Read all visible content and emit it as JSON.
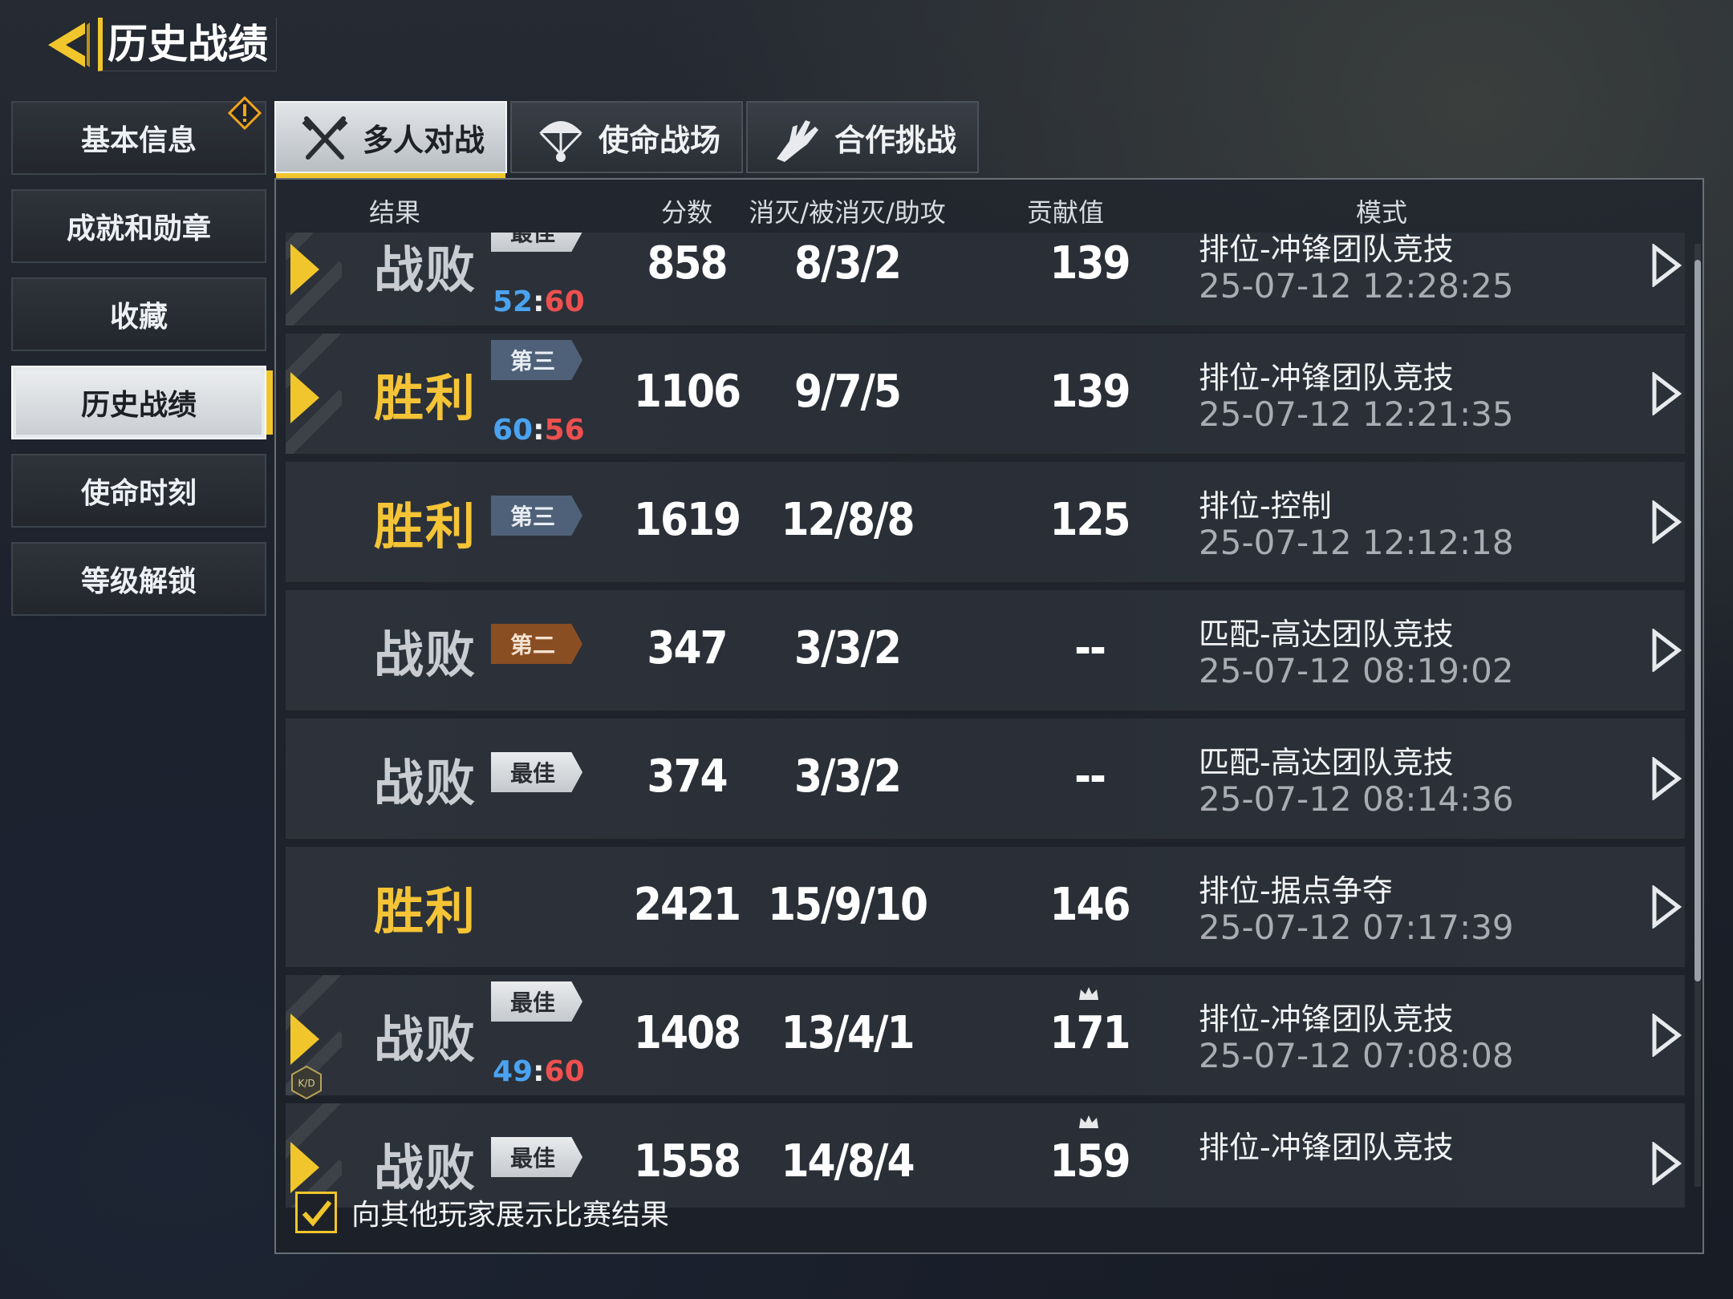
{
  "header": {
    "title": "历史战绩"
  },
  "sidebar": {
    "items": [
      {
        "label": "基本信息",
        "alert": true
      },
      {
        "label": "成就和勋章"
      },
      {
        "label": "收藏"
      },
      {
        "label": "历史战绩",
        "active": true
      },
      {
        "label": "使命时刻"
      },
      {
        "label": "等级解锁"
      }
    ]
  },
  "tabs": [
    {
      "label": "多人对战",
      "icon": "crossed-guns-icon",
      "active": true
    },
    {
      "label": "使命战场",
      "icon": "parachute-icon"
    },
    {
      "label": "合作挑战",
      "icon": "zombie-hand-icon"
    }
  ],
  "columns": {
    "result": "结果",
    "score": "分数",
    "kda": "消灭/被消灭/助攻",
    "contribution": "贡献值",
    "mode": "模式"
  },
  "matches": [
    {
      "result": "战败",
      "outcome": "lose",
      "marker": true,
      "badge": "最佳",
      "badge_type": "best",
      "ratio_blue": "52",
      "ratio_red": "60",
      "score": "858",
      "kda": "8/3/2",
      "contribution": "139",
      "mode": "排位-冲锋团队竞技",
      "time": "25-07-12 12:28:25"
    },
    {
      "result": "胜利",
      "outcome": "win",
      "marker": true,
      "badge": "第三",
      "badge_type": "third",
      "ratio_blue": "60",
      "ratio_red": "56",
      "score": "1106",
      "kda": "9/7/5",
      "contribution": "139",
      "mode": "排位-冲锋团队竞技",
      "time": "25-07-12 12:21:35"
    },
    {
      "result": "胜利",
      "outcome": "win",
      "badge": "第三",
      "badge_type": "third",
      "score": "1619",
      "kda": "12/8/8",
      "contribution": "125",
      "mode": "排位-控制",
      "time": "25-07-12 12:12:18"
    },
    {
      "result": "战败",
      "outcome": "lose",
      "badge": "第二",
      "badge_type": "second",
      "score": "347",
      "kda": "3/3/2",
      "contribution": "--",
      "mode": "匹配-高达团队竞技",
      "time": "25-07-12 08:19:02"
    },
    {
      "result": "战败",
      "outcome": "lose",
      "badge": "最佳",
      "badge_type": "best",
      "score": "374",
      "kda": "3/3/2",
      "contribution": "--",
      "mode": "匹配-高达团队竞技",
      "time": "25-07-12 08:14:36"
    },
    {
      "result": "胜利",
      "outcome": "win",
      "score": "2421",
      "kda": "15/9/10",
      "contribution": "146",
      "mode": "排位-据点争夺",
      "time": "25-07-12 07:17:39"
    },
    {
      "result": "战败",
      "outcome": "lose",
      "marker": true,
      "kd_badge": "K/D",
      "badge": "最佳",
      "badge_type": "best",
      "ratio_blue": "49",
      "ratio_red": "60",
      "score": "1408",
      "kda": "13/4/1",
      "contribution": "171",
      "crown": true,
      "mode": "排位-冲锋团队竞技",
      "time": "25-07-12 07:08:08"
    },
    {
      "result": "战败",
      "outcome": "lose",
      "marker": true,
      "badge": "最佳",
      "badge_type": "best",
      "score": "1558",
      "kda": "14/8/4",
      "contribution": "159",
      "crown": true,
      "mode": "排位-冲锋团队竞技",
      "time": ""
    }
  ],
  "footer": {
    "checkbox_label": "向其他玩家展示比赛结果",
    "checked": true
  },
  "colors": {
    "accent": "#f1c62c",
    "win": "#f4c436",
    "lose": "#c9ccd1",
    "ratio_blue": "#4aa3f0",
    "ratio_red": "#ee5050"
  }
}
